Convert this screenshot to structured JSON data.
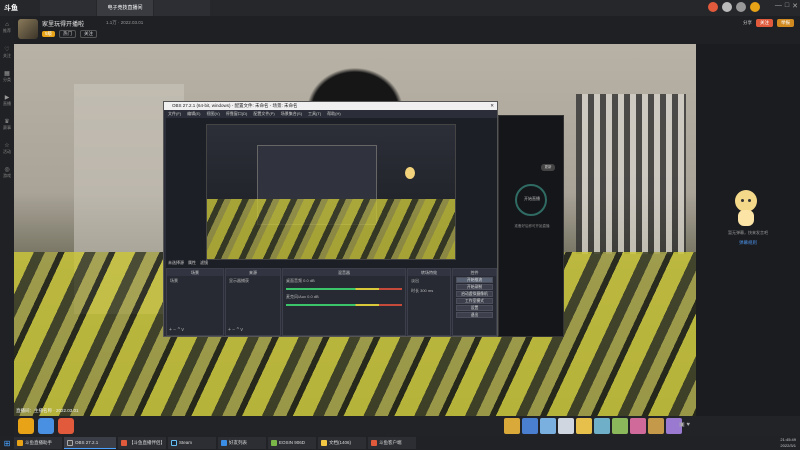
{
  "top_bar": {
    "logo": "斗鱼",
    "tabs": [
      "",
      "电子竞技直播间",
      ""
    ],
    "window_controls": [
      "—",
      "□",
      "✕"
    ]
  },
  "left_nav": {
    "items": [
      {
        "label": "推荐",
        "icon": "home-icon"
      },
      {
        "label": "关注",
        "icon": "heart-icon"
      },
      {
        "label": "分类",
        "icon": "grid-icon"
      },
      {
        "label": "直播",
        "icon": "live-icon"
      },
      {
        "label": "赛事",
        "icon": "trophy-icon"
      },
      {
        "label": "活动",
        "icon": "star-icon"
      },
      {
        "label": "游戏",
        "icon": "gamepad-icon"
      }
    ]
  },
  "room_header": {
    "title": "家里玩得开播啦",
    "meta": "1.1万 · 2022.03.01",
    "sub_badge": "5级",
    "sub_pills": [
      "热门",
      "关注"
    ],
    "right_label": "分享",
    "right_buttons": [
      "关注",
      "举报"
    ]
  },
  "video": {
    "caption": "直播间：主播名称 · 2022.03.01"
  },
  "obs": {
    "title": "OBS 27.2.1 (64-bit, windows) - 配置文件: 未命名 - 场景: 未命名",
    "menu": [
      "文件(F)",
      "编辑(E)",
      "视图(V)",
      "停靠窗口(D)",
      "配置文件(P)",
      "场景集合(S)",
      "工具(T)",
      "帮助(H)"
    ],
    "status_tag": "未选择源",
    "status_buttons": [
      "属性",
      "滤镜"
    ],
    "docks": {
      "scenes": {
        "title": "场景",
        "item": "场景"
      },
      "sources": {
        "title": "来源",
        "item": "显示器捕获"
      },
      "mixer": {
        "title": "混音器",
        "tracks": [
          "桌面音频 0.0 dB",
          "麦克风/Aux 0.0 dB"
        ]
      },
      "transitions": {
        "title": "转场特效",
        "rows": [
          "淡出",
          "时长 300 ms"
        ]
      },
      "controls": {
        "title": "控件",
        "buttons": [
          "开始推流",
          "开始录制",
          "启动虚拟摄像机",
          "工作室模式",
          "设置",
          "退出"
        ]
      }
    },
    "footer_glyphs": "+ − ^ v"
  },
  "floating_panel": {
    "badge": "更新",
    "live_text": "开始直播",
    "sub_text": "准备好后即可开始直播"
  },
  "right_panel": {
    "text": "暂无弹幕，快来发言吧",
    "link": "弹幕规则"
  },
  "gift_bar": {
    "right_text": "▣ ♥"
  },
  "taskbar": {
    "items": [
      {
        "label": "斗鱼直播助手",
        "color": "#e8a317"
      },
      {
        "label": "OBS 27.2.1",
        "color": "#444"
      },
      {
        "label": "【斗鱼直播伴侣】",
        "color": "#e05a3b"
      },
      {
        "label": "Steam",
        "color": "#1b2838"
      },
      {
        "label": "好友列表",
        "color": "#3a8ee6"
      },
      {
        "label": "EOSIN 906D",
        "color": "#7ab648"
      },
      {
        "label": "文档(1406)",
        "color": "#f2c744"
      },
      {
        "label": "斗鱼客户端",
        "color": "#e05a3b"
      }
    ],
    "time": "21:45:49",
    "date": "2022/3/1"
  },
  "colors": {
    "accent": "#e05a3b",
    "brand": "#e8a317",
    "link": "#4a90e2"
  }
}
